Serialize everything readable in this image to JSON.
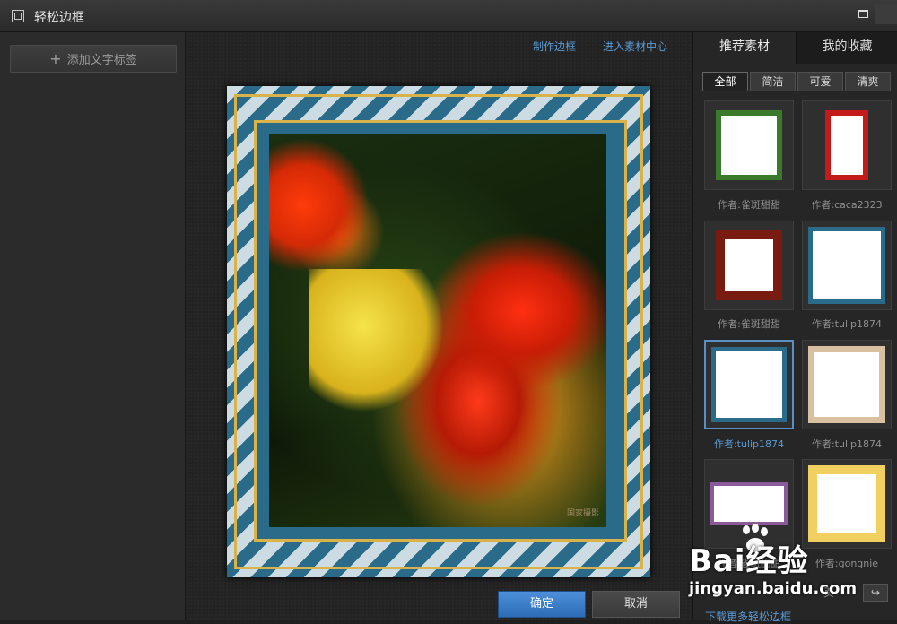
{
  "window": {
    "title": "轻松边框"
  },
  "left_panel": {
    "add_text_button": "添加文字标签",
    "add_icon": "+"
  },
  "canvas": {
    "links": {
      "make_frame": "制作边框",
      "material_center": "进入素材中心"
    },
    "photo_watermark": "国家摄影"
  },
  "right_panel": {
    "tabs": [
      {
        "label": "推荐素材",
        "active": true
      },
      {
        "label": "我的收藏",
        "active": false
      }
    ],
    "filters": [
      {
        "label": "全部",
        "selected": true
      },
      {
        "label": "简洁",
        "selected": false
      },
      {
        "label": "可爱",
        "selected": false
      },
      {
        "label": "清爽",
        "selected": false
      }
    ],
    "thumbnails": [
      {
        "author": "作者:雀斑甜甜",
        "selected": false
      },
      {
        "author": "作者:caca2323",
        "selected": false
      },
      {
        "author": "作者:雀斑甜甜",
        "selected": false
      },
      {
        "author": "作者:tulip1874",
        "selected": false
      },
      {
        "author": "作者:tulip1874",
        "selected": true
      },
      {
        "author": "作者:tulip1874",
        "selected": false
      },
      {
        "author": "作者:雀斑甜甜",
        "selected": false
      },
      {
        "author": "作者:gongnie",
        "selected": false
      }
    ],
    "pager": {
      "label": "页",
      "next_icon": "↪"
    },
    "download_more": "下载更多轻松边框"
  },
  "footer": {
    "ok": "确定",
    "cancel": "取消"
  },
  "watermark": {
    "brand": "Bai经验",
    "url": "jingyan.baidu.com"
  },
  "colors": {
    "accent": "#5b9bd5",
    "ok_button": "#2d6db8",
    "frame_blue": "#2a6b8a",
    "frame_gold": "#d9b24a"
  }
}
